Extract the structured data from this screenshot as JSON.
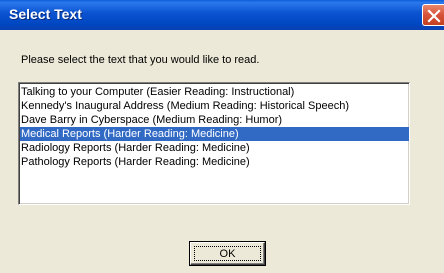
{
  "window": {
    "title": "Select Text",
    "close_icon": "close-icon"
  },
  "dialog": {
    "prompt": "Please select the text that you would like to read."
  },
  "list": {
    "items": [
      {
        "label": "Talking to your Computer (Easier Reading: Instructional)",
        "selected": false
      },
      {
        "label": "Kennedy's Inaugural Address (Medium Reading: Historical Speech)",
        "selected": false
      },
      {
        "label": "Dave Barry in Cyberspace (Medium Reading: Humor)",
        "selected": false
      },
      {
        "label": "Medical Reports (Harder Reading: Medicine)",
        "selected": true
      },
      {
        "label": "Radiology Reports (Harder Reading: Medicine)",
        "selected": false
      },
      {
        "label": "Pathology Reports (Harder Reading: Medicine)",
        "selected": false
      }
    ],
    "selected_color": "#316ac5"
  },
  "buttons": {
    "ok_label": "OK"
  },
  "colors": {
    "titlebar": "#0a52d0",
    "dialog_bg": "#ece9d8",
    "close_button": "#d6523a"
  }
}
